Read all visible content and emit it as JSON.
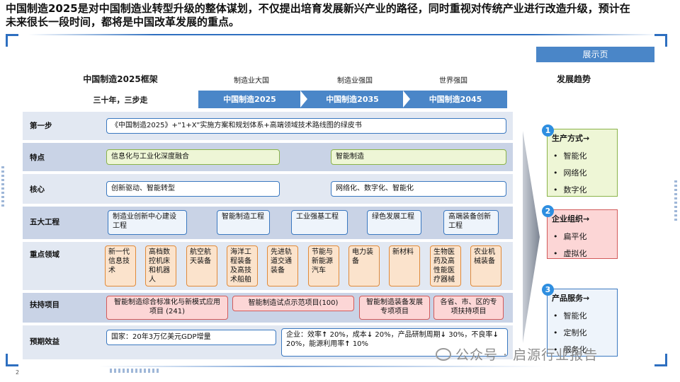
{
  "headline": "中国制造2025是对中国制造业转型升级的整体谋划，不仅提出培育发展新兴产业的路径，同时重视对传统产业进行改造升级，预计在未来很长一段时间，都将是中国改革发展的重点。",
  "show_page_tag": "展示页",
  "framework_title": "中国制造2025框架",
  "three_steps_label": "三十年，三步走",
  "phase_labels": [
    "制造业大国",
    "制造业强国",
    "世界强国"
  ],
  "phase_steps": [
    "中国制造2025",
    "中国制造2035",
    "中国制造2045"
  ],
  "trend_title": "发展趋势",
  "rows": {
    "step1": {
      "label": "第一步",
      "text": "《中国制造2025》+“1+X”实施方案和规划体系+高端领域技术路线图的绿皮书"
    },
    "features": {
      "label": "特点",
      "items": [
        "信息化与工业化深度融合",
        "智能制造"
      ]
    },
    "core": {
      "label": "核心",
      "items": [
        "创新驱动、智能转型",
        "网络化、数字化、智能化"
      ]
    },
    "projects": {
      "label": "五大工程",
      "items": [
        "制造业创新中心建设工程",
        "智能制造工程",
        "工业强基工程",
        "绿色发展工程",
        "高端装备创新工程"
      ]
    },
    "fields": {
      "label": "重点领域",
      "items": [
        "新一代信息技术",
        "高档数控机床和机器人",
        "航空航天装备",
        "海洋工程装备及高技术船舶",
        "先进轨道交通装备",
        "节能与新能源汽车",
        "电力装备",
        "新材料",
        "生物医药及高性能医疗器械",
        "农业机械装备"
      ]
    },
    "support": {
      "label": "扶持项目",
      "items": [
        "智能制造综合标准化与新模式应用项目 (241)",
        "智能制造试点示范项目(100)",
        "智能制造装备发展专项项目",
        "各省、市、区的专项扶持项目"
      ]
    },
    "benefits": {
      "label": "预期效益",
      "left": "国家：20年3万亿美元GDP增量",
      "right_a": "企业：效率",
      "right_b": "20%，成本",
      "right_c": "20%，产品研制周期",
      "right_d": "30%，不良率",
      "right_e": "20%，能源利用率",
      "right_f": "10%"
    }
  },
  "trends": [
    {
      "num": "1",
      "title": "生产方式→",
      "items": [
        "智能化",
        "网络化",
        "数字化"
      ],
      "color": "#8ab34a"
    },
    {
      "num": "2",
      "title": "企业组织→",
      "items": [
        "扁平化",
        "虚拟化"
      ],
      "color": "#d25a5a"
    },
    {
      "num": "3",
      "title": "产品服务→",
      "items": [
        "智能化",
        "定制化",
        "服务化"
      ],
      "color": "#3a78c0"
    }
  ],
  "watermark": "公众号 · 启源行业报告",
  "page_number": "2",
  "icons": {
    "up_arrow": "arrow-up-icon",
    "down_arrow": "arrow-down-icon",
    "watermark_logo": "wechat-icon"
  }
}
